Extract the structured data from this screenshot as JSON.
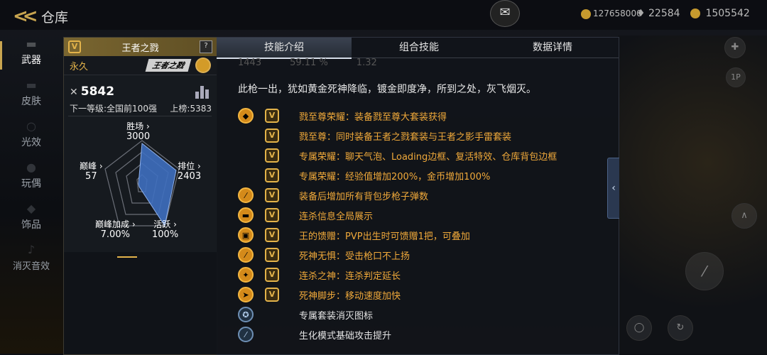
{
  "topbar": {
    "title": "仓库",
    "currencies": [
      "127658000",
      "22584",
      "1505542"
    ]
  },
  "nav": {
    "items": [
      {
        "label": "武器",
        "active": true
      },
      {
        "label": "皮肤",
        "active": false
      },
      {
        "label": "光效",
        "active": false
      },
      {
        "label": "玩偶",
        "active": false
      },
      {
        "label": "饰品",
        "active": false
      },
      {
        "label": "消灭音效",
        "active": false
      }
    ]
  },
  "card": {
    "name": "王者之戮",
    "badge": "V",
    "help": "?",
    "duration": "永久",
    "logo": "王者之戮",
    "kills": "5842",
    "next_level": "下一等级:全国前100强",
    "rank": "上榜:5383",
    "stats": {
      "shengchang": {
        "label": "胜场",
        "value": "3000"
      },
      "paiwei": {
        "label": "排位",
        "value": "2403"
      },
      "dianfeng": {
        "label": "巅峰",
        "value": "57"
      },
      "dianfeng_bonus": {
        "label": "巅峰加成",
        "value": "7.00%"
      },
      "huoyue": {
        "label": "活跃",
        "value": "100%"
      }
    }
  },
  "panel": {
    "tabs": [
      "技能介绍",
      "组合技能",
      "数据详情"
    ],
    "ghost": [
      "1443",
      "59.11 %",
      "1.32"
    ],
    "description": "此枪一出，犹如黄金死神降临，镀金即度净，所到之处，灰飞烟灭。",
    "skills": [
      {
        "icon": "diamond",
        "vip": true,
        "text": "戮至尊荣耀：装备戮至尊大套装获得",
        "style": "gold"
      },
      {
        "icon": "none",
        "vip": true,
        "text": "戮至尊：同时装备王者之戮套装与王者之影手雷套装",
        "style": "gold"
      },
      {
        "icon": "none",
        "vip": true,
        "text": "专属荣耀：聊天气泡、Loading边框、复活特效、仓库背包边框",
        "style": "gold"
      },
      {
        "icon": "none",
        "vip": true,
        "text": "专属荣耀：经验值增加200%，金币增加100%",
        "style": "gold"
      },
      {
        "icon": "ammo",
        "vip": true,
        "text": "装备后增加所有背包步枪子弹数",
        "style": "gold"
      },
      {
        "icon": "broadcast",
        "vip": true,
        "text": "连杀信息全局展示",
        "style": "gold"
      },
      {
        "icon": "gift",
        "vip": true,
        "text": "王的馈赠：PVP出生时可馈赠1把，可叠加",
        "style": "gold"
      },
      {
        "icon": "steady",
        "vip": true,
        "text": "死神无惧：受击枪口不上扬",
        "style": "gold"
      },
      {
        "icon": "streak",
        "vip": true,
        "text": "连杀之神：连杀判定延长",
        "style": "gold"
      },
      {
        "icon": "run",
        "vip": true,
        "text": "死神脚步：移动速度加快",
        "style": "gold"
      },
      {
        "icon": "blue-kill",
        "vip": false,
        "text": "专属套装消灭图标",
        "style": "white"
      },
      {
        "icon": "blue-attack",
        "vip": false,
        "text": "生化模式基础攻击提升",
        "style": "white"
      }
    ]
  }
}
